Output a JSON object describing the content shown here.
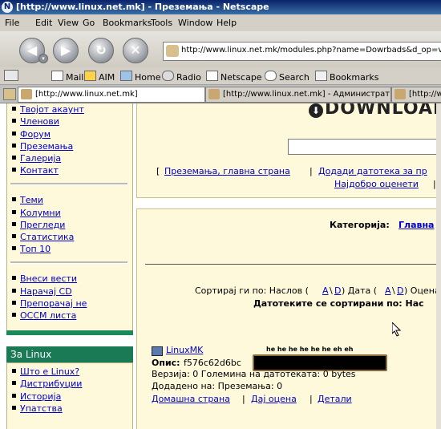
{
  "window": {
    "title": "[http://www.linux.net.mk] - Преземања - Netscape"
  },
  "menu": [
    "File",
    "Edit",
    "View",
    "Go",
    "Bookmarks",
    "Tools",
    "Window",
    "Help"
  ],
  "address": {
    "url": "http://www.linux.net.mk/modules.php?name=Dowrbads&d_op=views"
  },
  "personal_toolbar": [
    "Mail",
    "AIM",
    "Home",
    "Radio",
    "Netscape",
    "Search",
    "Bookmarks"
  ],
  "tabs": [
    "[http://www.linux.net.mk]",
    "[http://www.linux.net.mk] - Администрат...",
    "[http://www.li"
  ],
  "sidebar": {
    "group1": [
      "Твојот акаунт",
      "Членови",
      "Форум",
      "Преземања",
      "Галерија",
      "Контакт"
    ],
    "group2": [
      "Теми",
      "Колумни",
      "Прегледи",
      "Статистика",
      "Топ 10"
    ],
    "group3": [
      "Внеси вести",
      "Нарачај CD",
      "Препорачај не",
      "OCCM листа"
    ],
    "forlinux": {
      "title": "За Linux",
      "items": [
        "Што е Linux?",
        "Дистрибуции",
        "Историја",
        "Упатства"
      ]
    }
  },
  "main": {
    "downloads_logo": "DOWNLOADS",
    "nav_links": {
      "open": "[",
      "main": "Преземања, главна страна",
      "sep": "|",
      "add": "Додади датотека за пр",
      "top": "Најдобро оценети",
      "close": "|"
    },
    "category_label": "Категорија:",
    "category_link": "Главна",
    "sort_prefix": "Сортирај ги по: Наслов (",
    "sort_a": "A",
    "sort_d": "D",
    "sort_date": ") Датa (",
    "sort_rating": ") Оцена",
    "sorted_by": "Датотеките се сортирани по: Нас",
    "item": {
      "title_link": "LinuxMK",
      "overlay_text": "he he he he he he eh eh",
      "desc_label": "Опис:",
      "desc_value": "f576c62d6bc",
      "version_line": "Верзија: 0 Големина на датотеката: 0 bytes",
      "added_line": "Додадено на: Преземања: 0",
      "links": {
        "home": "Домашна страна",
        "rate": "Дај оцена",
        "details": "Детали",
        "sep": "|"
      }
    }
  }
}
